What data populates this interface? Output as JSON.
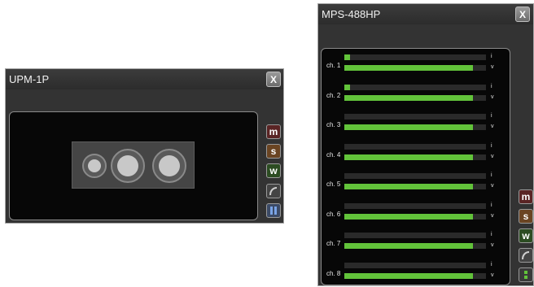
{
  "upm": {
    "title": "UPM-1P",
    "close_label": "X",
    "buttons": {
      "m": "m",
      "s": "s",
      "w": "w"
    }
  },
  "mps": {
    "title": "MPS-488HP",
    "close_label": "X",
    "buttons": {
      "m": "m",
      "s": "s",
      "w": "w"
    },
    "i_label": "i",
    "v_label": "v",
    "channels": [
      {
        "label": "ch. 1",
        "current_level": 0.04,
        "voltage_level": 0.91
      },
      {
        "label": "ch. 2",
        "current_level": 0.04,
        "voltage_level": 0.91
      },
      {
        "label": "ch. 3",
        "current_level": 0.0,
        "voltage_level": 0.91
      },
      {
        "label": "ch. 4",
        "current_level": 0.0,
        "voltage_level": 0.91
      },
      {
        "label": "ch. 5",
        "current_level": 0.0,
        "voltage_level": 0.91
      },
      {
        "label": "ch. 6",
        "current_level": 0.0,
        "voltage_level": 0.91
      },
      {
        "label": "ch. 7",
        "current_level": 0.0,
        "voltage_level": 0.91
      },
      {
        "label": "ch. 8",
        "current_level": 0.0,
        "voltage_level": 0.91
      }
    ]
  },
  "colors": {
    "meter_green": "#62c33a",
    "window_bg": "#333333",
    "panel_bg": "#070707"
  }
}
